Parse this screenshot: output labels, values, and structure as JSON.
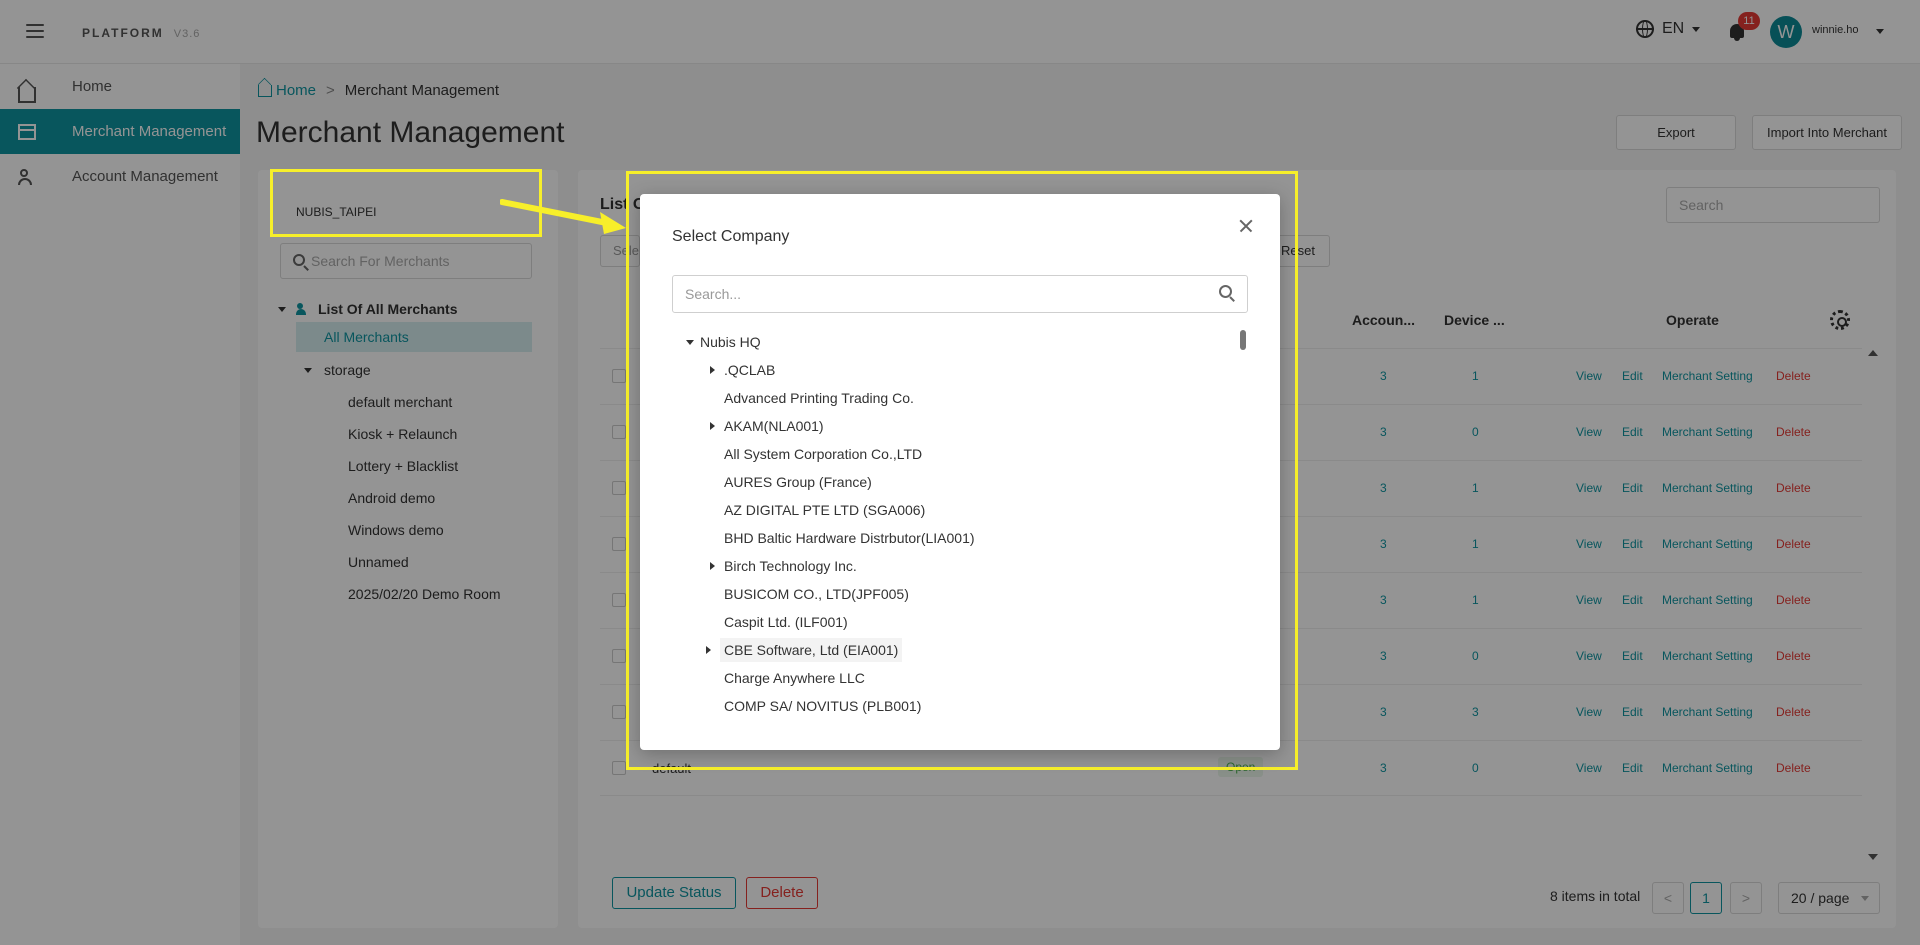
{
  "header": {
    "brand": "PLATFORM",
    "version": "V3.6",
    "language": "EN",
    "notification_count": "11",
    "avatar_initial": "W",
    "username": "winnie.ho"
  },
  "sidebar": {
    "items": [
      {
        "label": "Home",
        "icon": "home-icon"
      },
      {
        "label": "Merchant Management",
        "icon": "store-icon",
        "active": true
      },
      {
        "label": "Account Management",
        "icon": "account-icon"
      }
    ]
  },
  "breadcrumb": {
    "home": "Home",
    "separator": ">",
    "current": "Merchant Management"
  },
  "page": {
    "title": "Merchant Management",
    "export_label": "Export",
    "import_label": "Import Into Merchant"
  },
  "left_panel": {
    "company": "NUBIS_TAIPEI",
    "search_placeholder": "Search For Merchants",
    "tree_root": "List Of All Merchants",
    "all_merchants": "All Merchants",
    "group": "storage",
    "merchants": [
      "default merchant",
      "Kiosk + Relaunch",
      "Lottery + Blacklist",
      "Android demo",
      "Windows demo",
      "Unnamed",
      "2025/02/20 Demo Room"
    ]
  },
  "main_panel": {
    "title": "List O",
    "filter_text": "Sele",
    "search_placeholder": "Search",
    "reset_label": "Reset",
    "columns": {
      "accounts": "Accoun...",
      "devices": "Device ...",
      "operate": "Operate"
    },
    "actions": {
      "view": "View",
      "edit": "Edit",
      "setting": "Merchant Setting",
      "delete": "Delete"
    },
    "rows": [
      {
        "accounts": "3",
        "devices": "1"
      },
      {
        "accounts": "3",
        "devices": "0"
      },
      {
        "accounts": "3",
        "devices": "1"
      },
      {
        "accounts": "3",
        "devices": "1"
      },
      {
        "accounts": "3",
        "devices": "1"
      },
      {
        "accounts": "3",
        "devices": "0"
      },
      {
        "accounts": "3",
        "devices": "3"
      },
      {
        "name": "default",
        "status": "Open",
        "accounts": "3",
        "devices": "0"
      }
    ],
    "update_status_label": "Update Status",
    "delete_label": "Delete",
    "items_total": "8 items in total",
    "prev": "<",
    "next": ">",
    "current_page": "1",
    "page_size": "20 / page"
  },
  "modal": {
    "title": "Select Company",
    "search_placeholder": "Search...",
    "root": "Nubis HQ",
    "companies": [
      {
        "label": ".QCLAB",
        "expandable": true
      },
      {
        "label": "Advanced Printing Trading Co.",
        "expandable": false
      },
      {
        "label": "AKAM(NLA001)",
        "expandable": true
      },
      {
        "label": "All System Corporation Co.,LTD",
        "expandable": false
      },
      {
        "label": "AURES Group (France)",
        "expandable": false
      },
      {
        "label": "AZ DIGITAL PTE LTD (SGA006)",
        "expandable": false
      },
      {
        "label": "BHD Baltic Hardware Distrbutor(LIA001)",
        "expandable": false
      },
      {
        "label": "Birch Technology Inc.",
        "expandable": true
      },
      {
        "label": "BUSICOM CO., LTD(JPF005)",
        "expandable": false
      },
      {
        "label": "Caspit Ltd. (ILF001)",
        "expandable": false
      },
      {
        "label": "CBE Software, Ltd (EIA001)",
        "expandable": true
      },
      {
        "label": "Charge Anywhere LLC",
        "expandable": false
      },
      {
        "label": "COMP SA/ NOVITUS (PLB001)",
        "expandable": false
      }
    ]
  },
  "colors": {
    "accent": "#0e94a1",
    "highlight": "#f7ef2a",
    "danger": "#e53935"
  }
}
